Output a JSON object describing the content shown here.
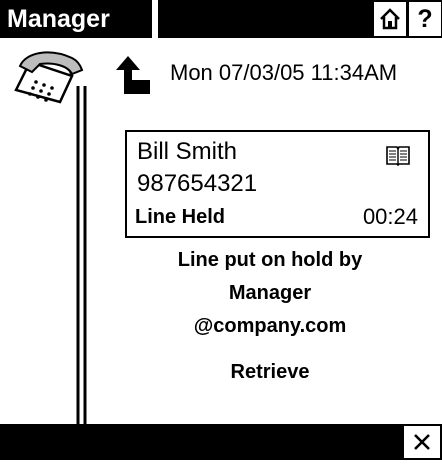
{
  "header": {
    "title": "Manager",
    "home_icon": "home-icon",
    "help_label": "?"
  },
  "status": {
    "datetime": "Mon 07/03/05 11:34AM"
  },
  "call": {
    "caller_name": "Bill Smith",
    "caller_number": "987654321",
    "status": "Line Held",
    "timer": "00:24",
    "contact_icon": "address-book-icon"
  },
  "message": {
    "line1": "Line put on hold by",
    "line2": "Manager",
    "line3": "@company.com"
  },
  "actions": {
    "retrieve_label": "Retrieve",
    "close_icon": "close-icon"
  },
  "colors": {
    "bar": "#000000",
    "background": "#ffffff"
  }
}
